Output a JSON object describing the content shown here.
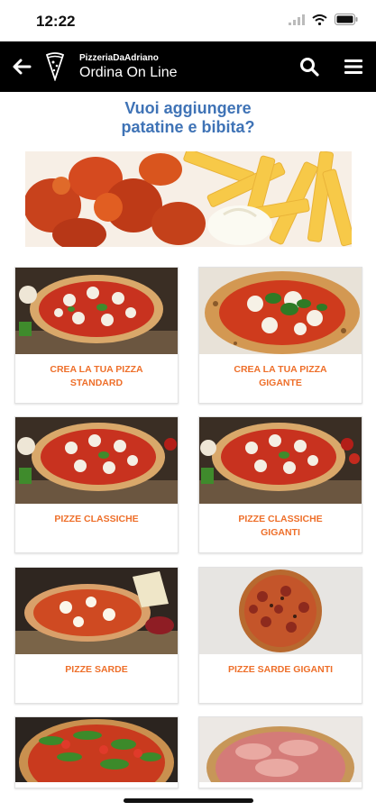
{
  "status": {
    "time": "12:22"
  },
  "header": {
    "brand": "PizzeriaDaAdriano",
    "title": "Ordina On Line"
  },
  "promo": {
    "line1": "Vuoi aggiungere",
    "line2": "patatine e bibita?"
  },
  "cards": [
    {
      "line1": "CREA LA TUA PIZZA",
      "line2": "STANDARD"
    },
    {
      "line1": "CREA LA TUA PIZZA",
      "line2": "GIGANTE"
    },
    {
      "line1": "PIZZE CLASSICHE",
      "line2": ""
    },
    {
      "line1": "PIZZE CLASSICHE",
      "line2": "GIGANTI"
    },
    {
      "line1": "PIZZE SARDE",
      "line2": ""
    },
    {
      "line1": "PIZZE SARDE GIGANTI",
      "line2": ""
    }
  ],
  "colors": {
    "header": "#000000",
    "promo_text": "#3f73b6",
    "card_label": "#ee6f2a"
  },
  "icons": [
    "back-arrow-icon",
    "pizza-slice-logo-icon",
    "search-icon",
    "hamburger-menu-icon",
    "signal-icon",
    "wifi-icon",
    "battery-icon"
  ]
}
